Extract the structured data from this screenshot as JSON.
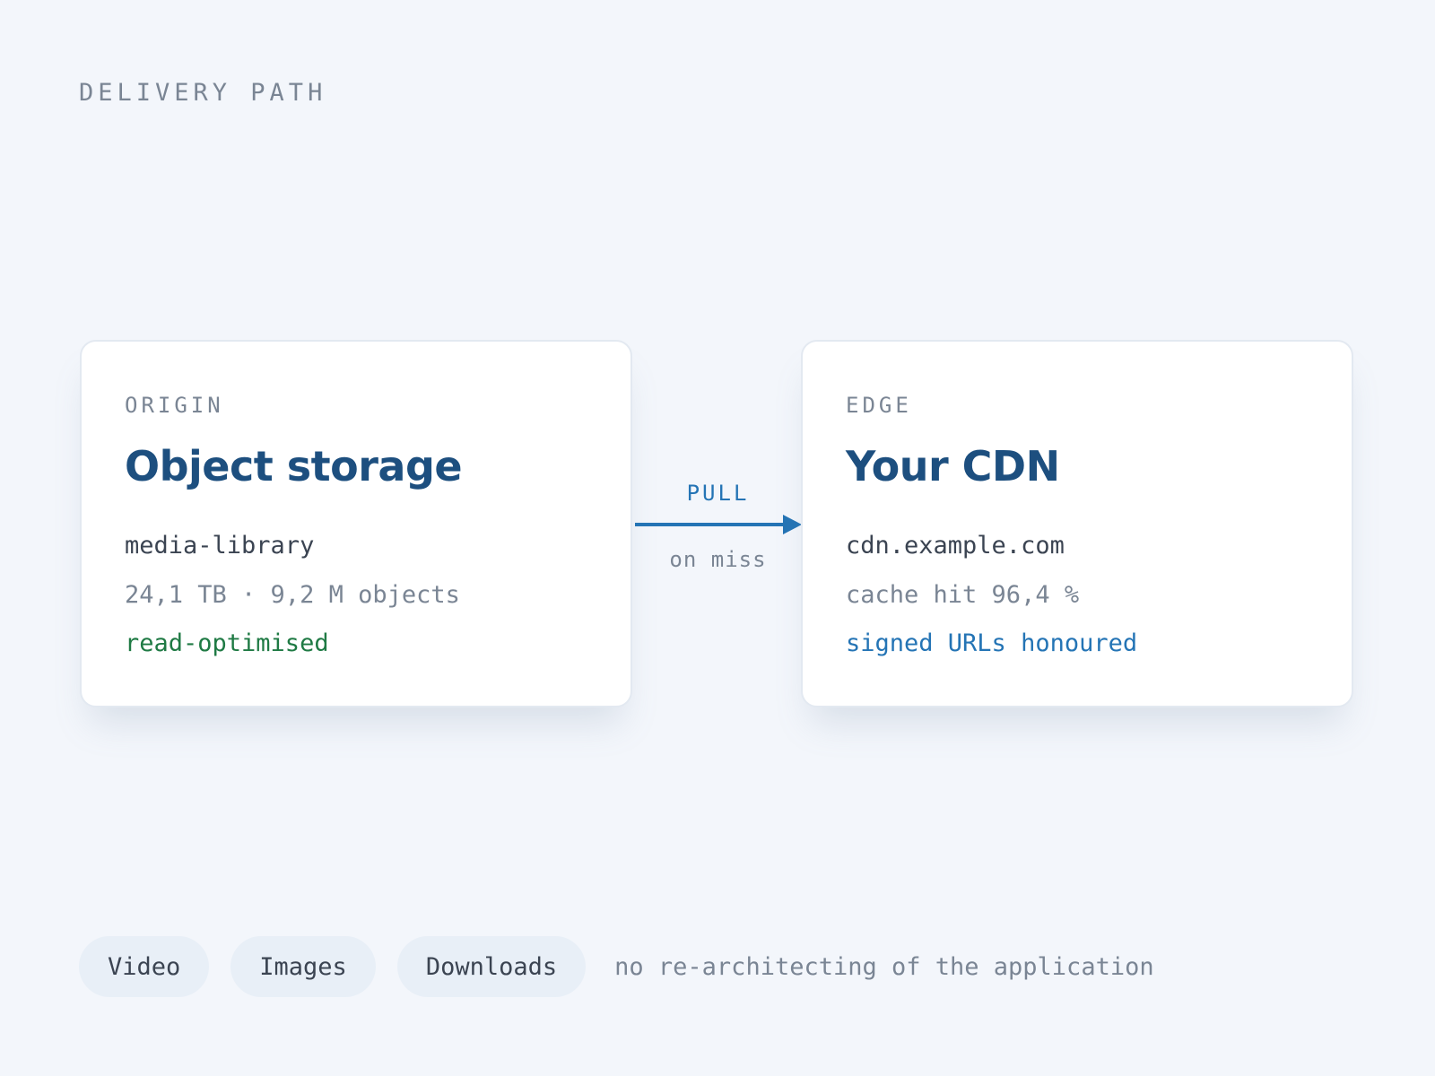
{
  "section_label": "DELIVERY PATH",
  "origin": {
    "kicker": "ORIGIN",
    "title": "Object storage",
    "name": "media-library",
    "stats": "24,1 TB · 9,2 M objects",
    "note": "read-optimised"
  },
  "connector": {
    "label": "PULL",
    "condition": "on miss"
  },
  "edge": {
    "kicker": "EDGE",
    "title": "Your CDN",
    "name": "cdn.example.com",
    "stats": "cache hit 96,4 %",
    "note": "signed URLs honoured"
  },
  "chips": [
    "Video",
    "Images",
    "Downloads"
  ],
  "footnote": "no re-architecting of the application",
  "colors": {
    "background": "#f3f6fb",
    "title": "#1d4f7f",
    "accent": "#2474b5",
    "positive": "#1f7a44",
    "muted": "#7a8594"
  }
}
